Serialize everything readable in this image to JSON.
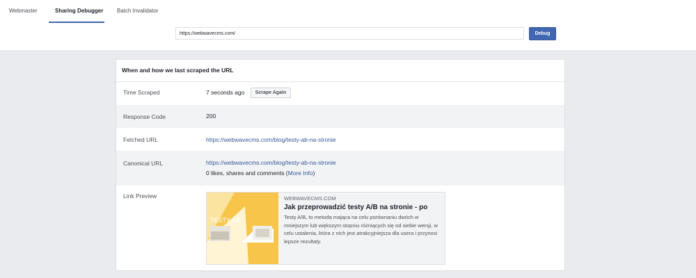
{
  "tabs": [
    {
      "label": "Webmaster"
    },
    {
      "label": "Sharing Debugger"
    },
    {
      "label": "Batch Invalidator"
    }
  ],
  "url_input": {
    "value": "https://webwavecms.com/"
  },
  "debug_button": {
    "label": "Debug"
  },
  "card": {
    "title": "When and how we last scraped the URL",
    "rows": {
      "time_scraped": {
        "label": "Time Scraped",
        "value": "7 seconds ago",
        "button": "Scrape Again"
      },
      "response_code": {
        "label": "Response Code",
        "value": "200"
      },
      "fetched_url": {
        "label": "Fetched URL",
        "value": "https://webwavecms.com/blog/testy-ab-na-stronie"
      },
      "canonical_url": {
        "label": "Canonical URL",
        "value": "https://webwavecms.com/blog/testy-ab-na-stronie",
        "stats_text": "0 likes, shares and comments (",
        "more_info": "More Info",
        "stats_close": ")"
      },
      "link_preview": {
        "label": "Link Preview"
      }
    },
    "preview": {
      "image_text": "TESTY AB",
      "domain": "WEBWAVECMS.COM",
      "title": "Jak przeprowadzić testy A/B na stronie - po",
      "description": "Testy A/B, to metoda mająca na celu porównaniu dwóch w mniejszym lub większym stopniu różniących się od siebie wersji, w celu ustalenia, która z nich jest atrakcyjniejsza dla usera i przynosi lepsze rezultaty."
    }
  },
  "colors": {
    "accent": "#4267b2",
    "link": "#365899",
    "preview_yellow": "#f7c54a"
  }
}
